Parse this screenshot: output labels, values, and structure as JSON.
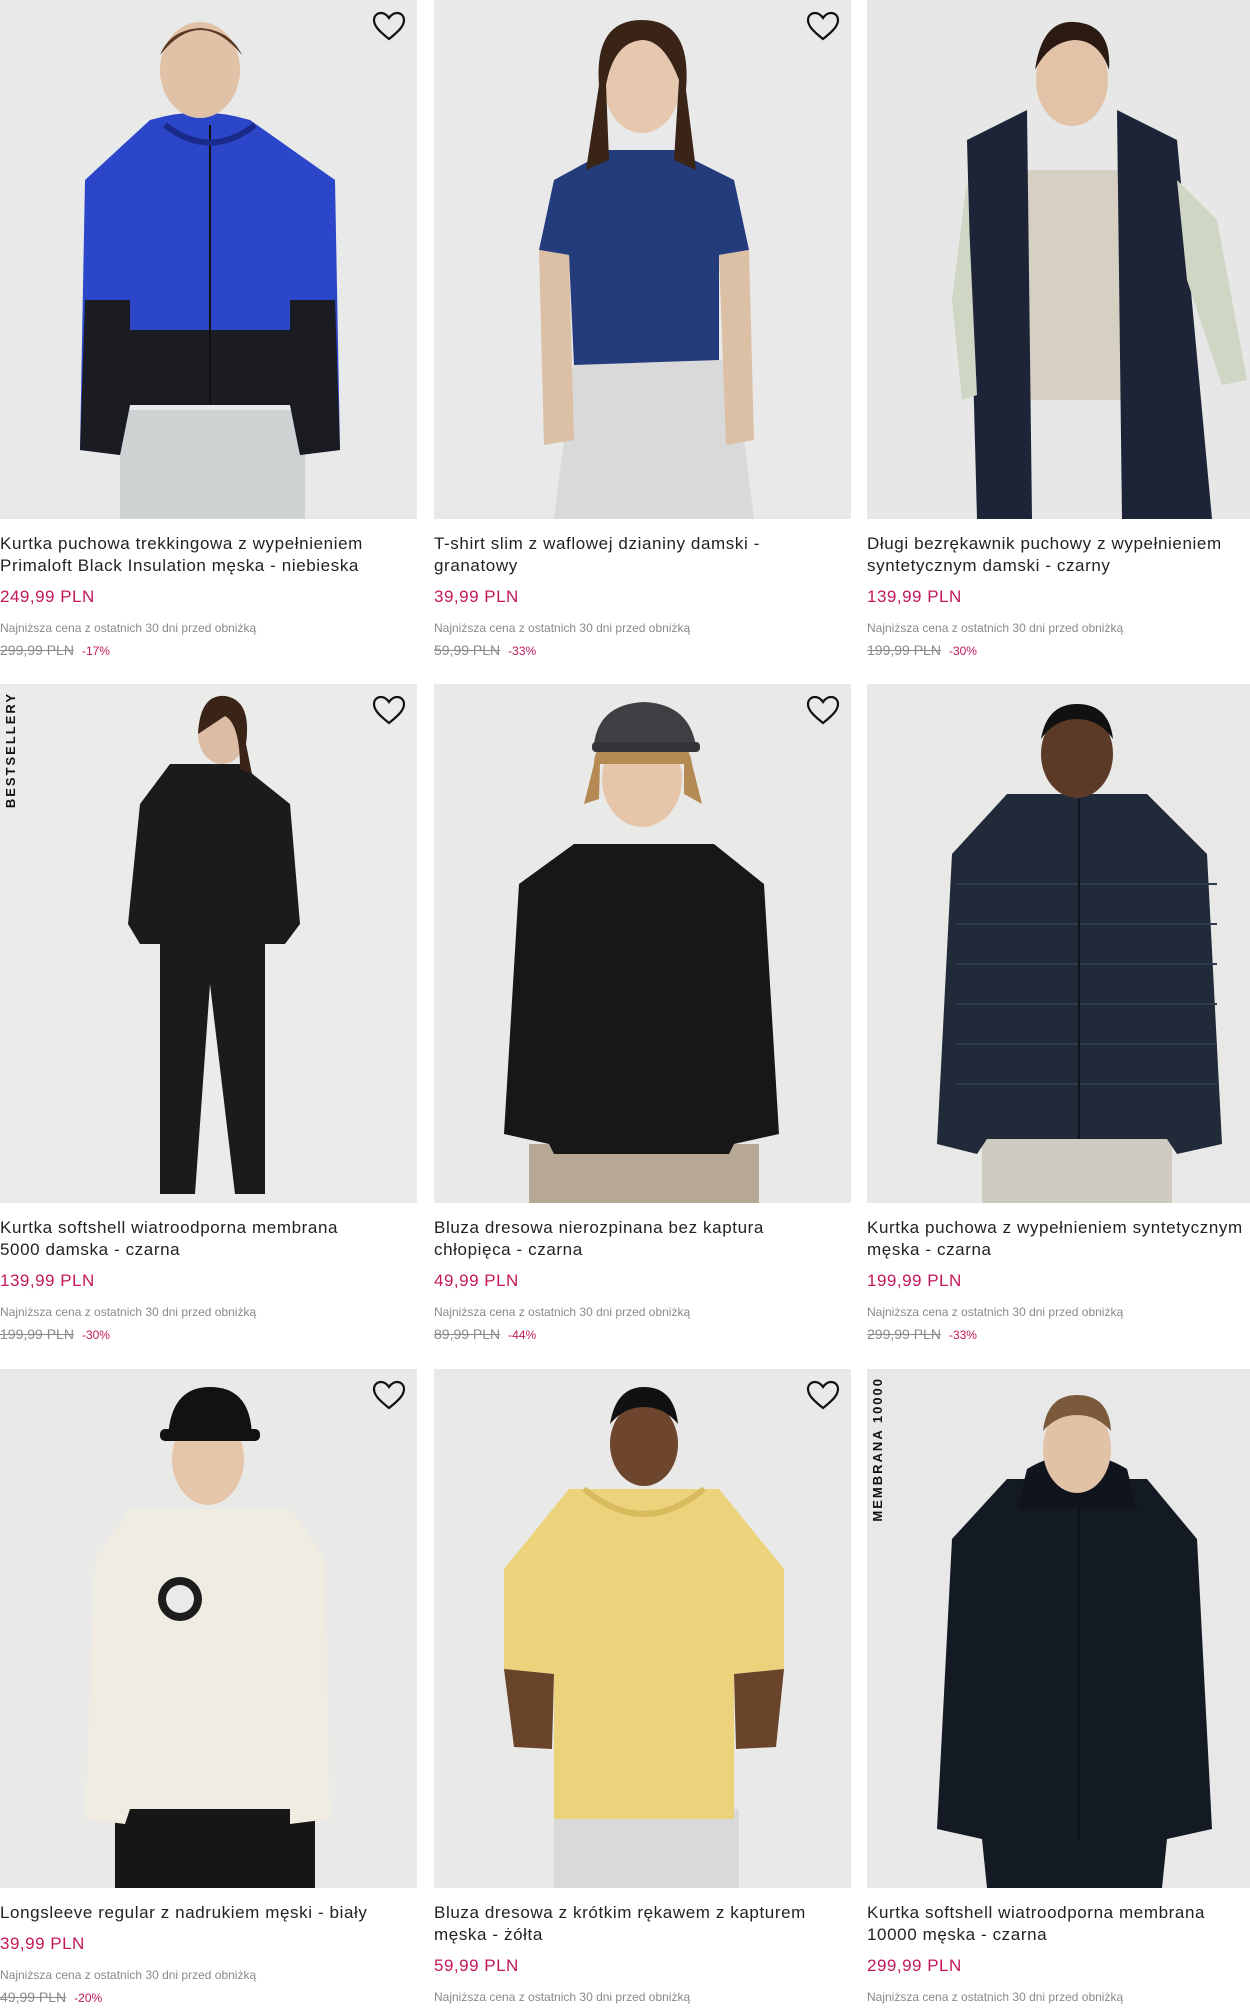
{
  "products": [
    {
      "name": "Kurtka puchowa trekkingowa z wypełnieniem\nPrimaloft Black Insulation męska - niebieska",
      "price": "249,99 PLN",
      "lowest": "Najniższa cena z ostatnich 30 dni przed obniżką",
      "old_price": "299,99 PLN",
      "discount": "-17%",
      "badge": ""
    },
    {
      "name": "T-shirt slim z waflowej dzianiny damski -\ngranatowy",
      "price": "39,99 PLN",
      "lowest": "Najniższa cena z ostatnich 30 dni przed obniżką",
      "old_price": "59,99 PLN",
      "discount": "-33%",
      "badge": ""
    },
    {
      "name": "Długi bezrękawnik puchowy z wypełnieniem\nsyntetycznym damski - czarny",
      "price": "139,99 PLN",
      "lowest": "Najniższa cena z ostatnich 30 dni przed obniżką",
      "old_price": "199,99 PLN",
      "discount": "-30%",
      "badge": ""
    },
    {
      "name": "Kurtka softshell wiatroodporna membrana\n5000 damska - czarna",
      "price": "139,99 PLN",
      "lowest": "Najniższa cena z ostatnich 30 dni przed obniżką",
      "old_price": "199,99 PLN",
      "discount": "-30%",
      "badge": "BESTSELLERY"
    },
    {
      "name": "Bluza dresowa nierozpinana bez kaptura\nchłopięca - czarna",
      "price": "49,99 PLN",
      "lowest": "Najniższa cena z ostatnich 30 dni przed obniżką",
      "old_price": "89,99 PLN",
      "discount": "-44%",
      "badge": ""
    },
    {
      "name": "Kurtka puchowa z wypełnieniem syntetycznym\nmęska - czarna",
      "price": "199,99 PLN",
      "lowest": "Najniższa cena z ostatnich 30 dni przed obniżką",
      "old_price": "299,99 PLN",
      "discount": "-33%",
      "badge": ""
    },
    {
      "name": "Longsleeve regular z nadrukiem męski - biały",
      "price": "39,99 PLN",
      "lowest": "Najniższa cena z ostatnich 30 dni przed obniżką",
      "old_price": "49,99 PLN",
      "discount": "-20%",
      "badge": ""
    },
    {
      "name": "Bluza dresowa z krótkim rękawem z kapturem\nmęska - żółta",
      "price": "59,99 PLN",
      "lowest": "Najniższa cena z ostatnich 30 dni przed obniżką",
      "old_price": "",
      "discount": "",
      "badge": ""
    },
    {
      "name": "Kurtka softshell wiatroodporna membrana\n10000 męska - czarna",
      "price": "299,99 PLN",
      "lowest": "Najniższa cena z ostatnich 30 dni przed obniżką",
      "old_price": "",
      "discount": "",
      "badge": "MEMBRANA 10000"
    }
  ],
  "icons": {
    "favorite": "heart-outline-icon"
  },
  "colors": {
    "sale_price": "#c2185b",
    "muted": "#8a8a8a",
    "photo_bg": "#e9e9e8"
  }
}
